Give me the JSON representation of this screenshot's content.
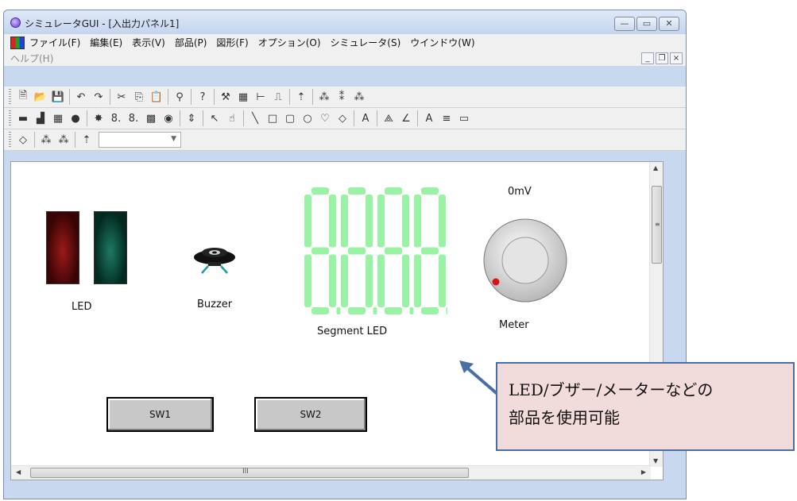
{
  "window": {
    "title": "シミュレータGUI - [入出力パネル1]",
    "caption_buttons": {
      "minimize": "—",
      "maximize": "▭",
      "close": "✕"
    }
  },
  "menu": {
    "items": [
      "ファイル(F)",
      "編集(E)",
      "表示(V)",
      "部品(P)",
      "図形(F)",
      "オプション(O)",
      "シミュレータ(S)",
      "ウインドウ(W)"
    ],
    "help": "ヘルプ(H)",
    "mdi_buttons": {
      "minimize": "_",
      "restore": "❐",
      "close": "×"
    }
  },
  "toolbar1": {
    "icons": [
      "new-icon",
      "open-icon",
      "save-icon",
      "undo-icon",
      "redo-icon",
      "cut-icon",
      "copy-icon",
      "paste-icon",
      "find-icon",
      "help-icon",
      "build-icon",
      "panel-icon",
      "bar-icon",
      "wave-icon",
      "probe-icon",
      "tree1-icon",
      "tree2-icon",
      "tree3-icon"
    ],
    "glyphs": [
      "🗎",
      "📂",
      "💾",
      "↶",
      "↷",
      "✂",
      "⎘",
      "📋",
      "⚲",
      "?",
      "⚒",
      "▦",
      "⊢",
      "⎍",
      "⇡",
      "⁂",
      "⁑",
      "⁂"
    ]
  },
  "toolbar2": {
    "glyphs": [
      "▬",
      "▟",
      "▦",
      "●",
      "✸",
      "8.",
      "8.",
      "▩",
      "◉",
      "⇕",
      "↖",
      "☝",
      "╲",
      "□",
      "▢",
      "○",
      "♡",
      "◇",
      "A",
      "⟁",
      "∠",
      "A",
      "≡",
      "▭"
    ]
  },
  "toolbar3": {
    "glyphs": [
      "◇",
      "⁂",
      "⁂",
      "⇡"
    ],
    "combo_value": ""
  },
  "canvas": {
    "led_label": "LED",
    "buzzer_label": "Buzzer",
    "segment_label": "Segment LED",
    "meter_value": "0mV",
    "meter_label": "Meter",
    "sw1_label": "SW1",
    "sw2_label": "SW2"
  },
  "scroll": {
    "v_up": "▲",
    "v_down": "▼",
    "v_grip": "≡",
    "h_left": "◀",
    "h_right": "▶",
    "h_grip": "III"
  },
  "callout": {
    "line1": "LED/ブザー/メーターなどの",
    "line2": "部品を使用可能"
  },
  "colors": {
    "titlebar": "#c8d8ee",
    "segment_green": "#9af2a4",
    "callout_fill": "#f2dcdb",
    "callout_border": "#4a6fa5",
    "meter_dot": "#e01010"
  }
}
